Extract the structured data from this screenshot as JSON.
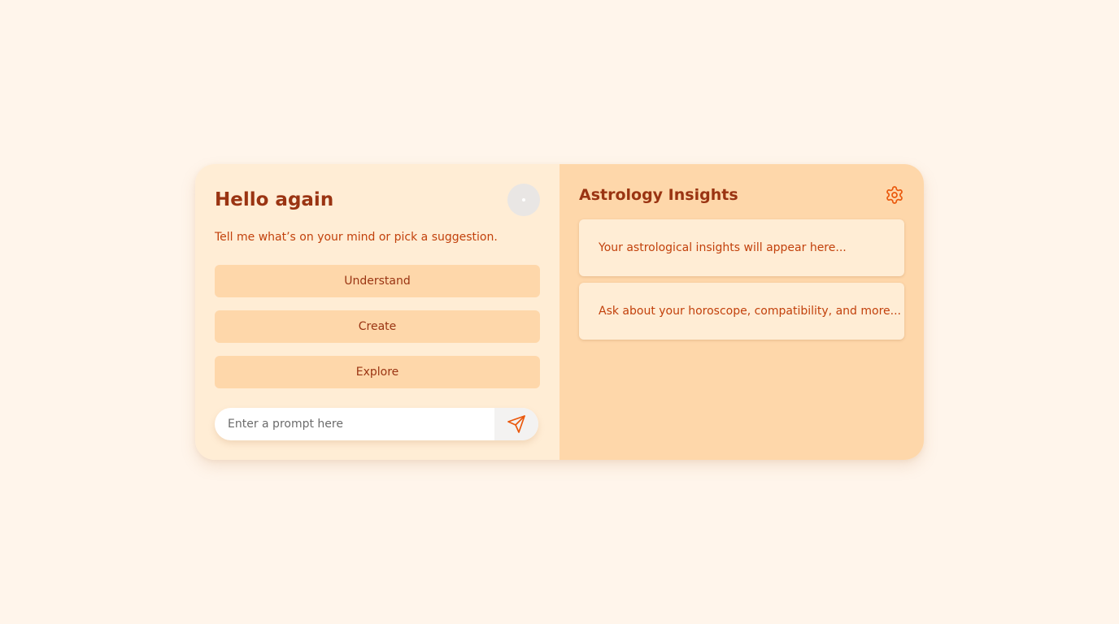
{
  "left_panel": {
    "greeting": "Hello again",
    "subtitle": "Tell me what’s on your mind or pick a suggestion.",
    "suggestions": [
      {
        "label": "Understand"
      },
      {
        "label": "Create"
      },
      {
        "label": "Explore"
      }
    ],
    "prompt": {
      "placeholder": "Enter a prompt here",
      "value": ""
    },
    "icons": {
      "avatar": "avatar",
      "send": "send-icon"
    }
  },
  "right_panel": {
    "title": "Astrology Insights",
    "settings_icon": "gear-icon",
    "cards": [
      {
        "text": "Your astrological insights will appear here..."
      },
      {
        "text": "Ask about your horoscope, compatibility, and more..."
      }
    ]
  },
  "colors": {
    "page_background": "#fff5eb",
    "left_panel_background": "#ffedd5",
    "right_panel_background": "#fed7aa",
    "heading": "#9a3412",
    "body_text": "#c2410c",
    "accent_icon": "#ea580c"
  }
}
